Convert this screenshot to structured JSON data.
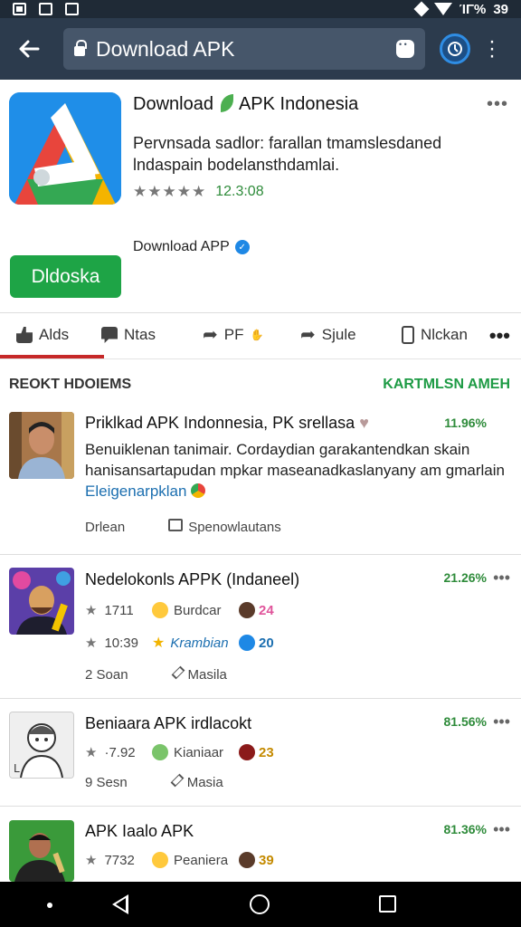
{
  "status_bar": {
    "signal_text": "ΊΓ%",
    "time": "39"
  },
  "browser": {
    "url_text": "Download APK"
  },
  "app": {
    "title_part1": "Download",
    "title_part2": "APK Indonesia",
    "description": "Pervnsada sadlor:  farallan tmamslesdaned lndaspain bodelansthdamlai.",
    "stars": "★★★★★",
    "rating": "12.3:08",
    "download_label": "Download APP",
    "install_button": "Dldoska"
  },
  "actions": [
    {
      "label": "Alds"
    },
    {
      "label": "Ntas"
    },
    {
      "label": "PF"
    },
    {
      "label": "Sjule"
    },
    {
      "label": "Nlckan"
    }
  ],
  "section": {
    "left": "REOKT HDOIEMS",
    "right": "KARTMLSN AMEH"
  },
  "rows": [
    {
      "title": "Priklkad APK Indonnesia, PK srellasa",
      "percent": "11.96%",
      "body": "Benuiklenan tanimair. Cordaydian garakantendkan skain hanisansartaрudan mpkar maseanadkaslanyany am gmarlain",
      "link": "Eleigenarpklan",
      "foot_left": "Drlean",
      "foot_right": "Spenowlautans"
    },
    {
      "title": "Nedelokonls APPK (Indaneel)",
      "percent": "21.26%",
      "line1": {
        "stat": "1711",
        "name": "Burdcar",
        "count": "24"
      },
      "line2": {
        "stat": "10:39",
        "name": "Krambian",
        "count": "20"
      },
      "foot_left": "2 Soan",
      "foot_right": "Masila"
    },
    {
      "title": "Beniaara APK irdlacokt",
      "percent": "81.56%",
      "line1": {
        "stat": "·7.92",
        "name": "Kianiaar",
        "count": "23"
      },
      "foot_left": "9 Sesn",
      "foot_right": "Masia"
    },
    {
      "title": "APK Iaalo APK",
      "percent": "81.36%",
      "line1": {
        "stat": "7732",
        "name": "Peaniera",
        "count": "39"
      }
    }
  ],
  "colors": {
    "accent_green": "#1ea446",
    "toolbar": "#2c3b4d",
    "tab_active": "#c62828",
    "link_blue": "#1c6fb0"
  }
}
